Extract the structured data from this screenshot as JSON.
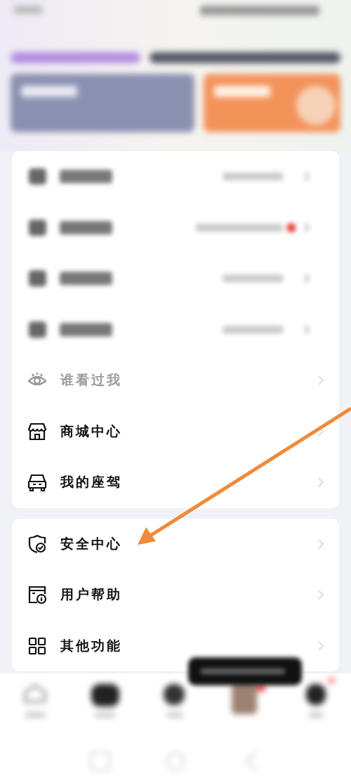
{
  "menu_groups": [
    {
      "items": [
        {
          "kind": "blurred"
        },
        {
          "kind": "blurred",
          "badge_dot": true
        },
        {
          "kind": "blurred"
        },
        {
          "kind": "blurred"
        },
        {
          "kind": "item",
          "label": "谁看过我",
          "dimmed": true
        },
        {
          "kind": "item",
          "label": "商城中心",
          "dimmed": false
        },
        {
          "kind": "item",
          "label": "我的座驾",
          "dimmed": false
        }
      ]
    },
    {
      "items": [
        {
          "kind": "item",
          "label": "安全中心",
          "dimmed": false
        },
        {
          "kind": "item",
          "label": "用户帮助",
          "dimmed": false
        },
        {
          "kind": "item",
          "label": "其他功能",
          "dimmed": false
        }
      ]
    }
  ],
  "annotation": {
    "kind": "arrow",
    "color": "#f08a3a"
  }
}
